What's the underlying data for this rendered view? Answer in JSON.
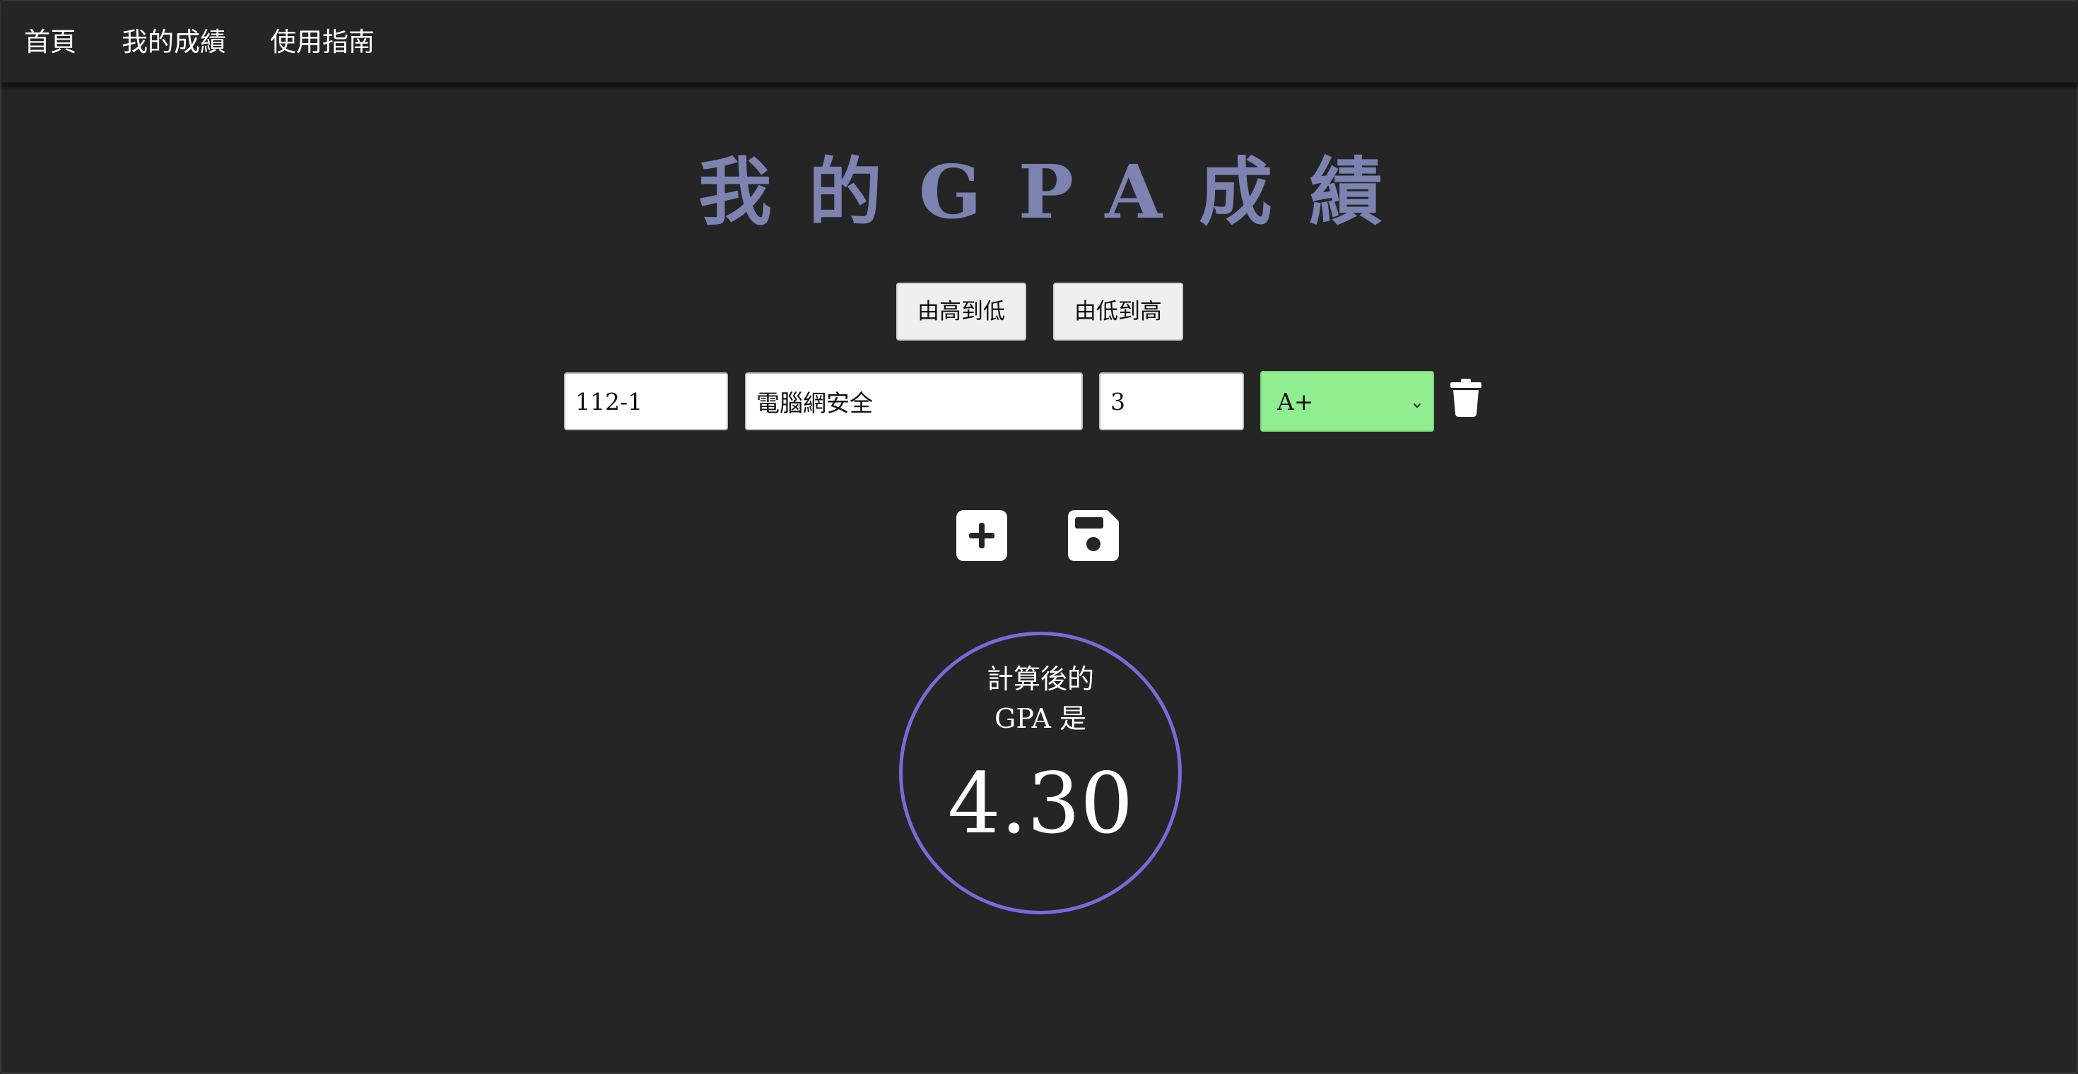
{
  "nav": {
    "home": "首頁",
    "my_grades": "我的成績",
    "guide": "使用指南"
  },
  "title": "我的GPA成績",
  "sort": {
    "desc_label": "由高到低",
    "asc_label": "由低到高"
  },
  "course_row": {
    "semester": "112-1",
    "course": "電腦網安全",
    "credits": "3",
    "grade": "A+"
  },
  "icons": {
    "delete": "trash-icon",
    "add": "plus-square-icon",
    "save": "floppy-disk-icon"
  },
  "result": {
    "label_line1": "計算後的",
    "label_line2": "GPA 是",
    "gpa": "4.30"
  },
  "colors": {
    "background": "#252525",
    "title": "#7c83b1",
    "grade_select": "#90ee90",
    "circle": "#7b68d9"
  }
}
